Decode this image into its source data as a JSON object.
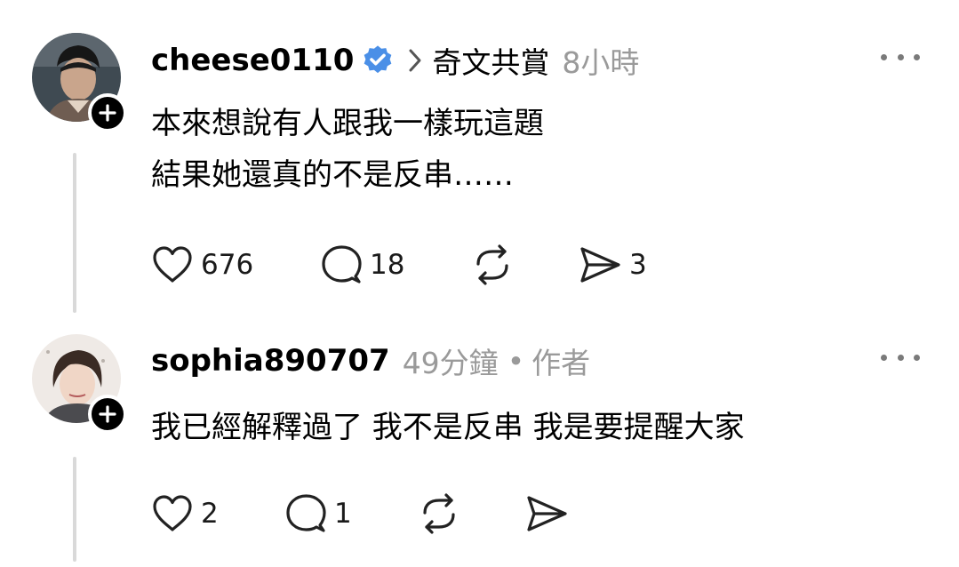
{
  "posts": [
    {
      "username": "cheese0110",
      "verified": true,
      "topic": "奇文共賞",
      "time": "8小時",
      "lines": [
        "本來想說有人跟我一樣玩這題",
        "結果她還真的不是反串……"
      ],
      "likes": "676",
      "replies": "18",
      "shares": "3"
    },
    {
      "username": "sophia890707",
      "time": "49分鐘",
      "separator": "•",
      "author_tag": "作者",
      "lines": [
        "我已經解釋過了 我不是反串 我是要提醒大家"
      ],
      "likes": "2",
      "replies": "1"
    }
  ],
  "colors": {
    "verified_badge": "#4a8fe7",
    "muted_text": "#9a9a9a",
    "thread_line": "#d9d9d9"
  },
  "icons": [
    "verified-icon",
    "chevron-right-icon",
    "more-dots-icon",
    "plus-icon",
    "heart-icon",
    "comment-icon",
    "repost-icon",
    "share-icon"
  ]
}
